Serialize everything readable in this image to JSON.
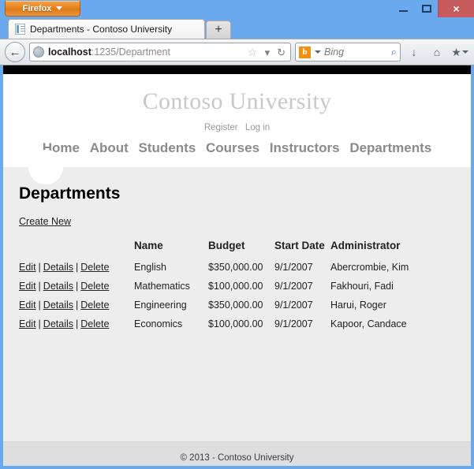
{
  "window": {
    "app_button_label": "Firefox",
    "controls": {
      "minimize": "minimize-icon",
      "maximize": "maximize-icon",
      "close": "×"
    }
  },
  "tabbar": {
    "active_tab_title": "Departments - Contoso University",
    "new_tab_label": "+"
  },
  "toolbar": {
    "back_glyph": "←",
    "url_host": "localhost",
    "url_rest": ":1235/Department",
    "star_glyph": "☆",
    "dropdown_glyph": "▾",
    "reload_glyph": "↻",
    "search_engine_letter": "b",
    "search_placeholder": "Bing",
    "search_glyph": "⌕",
    "download_glyph": "↓",
    "home_glyph": "⌂",
    "bookmarks_glyph": "★"
  },
  "site": {
    "title": "Contoso University",
    "account_links": [
      {
        "label": "Register"
      },
      {
        "label": "Log in"
      }
    ],
    "nav": [
      {
        "label": "Home"
      },
      {
        "label": "About"
      },
      {
        "label": "Students"
      },
      {
        "label": "Courses"
      },
      {
        "label": "Instructors"
      },
      {
        "label": "Departments"
      }
    ]
  },
  "main": {
    "page_title": "Departments",
    "create_new_label": "Create New",
    "table": {
      "headers": {
        "actions": "",
        "name": "Name",
        "budget": "Budget",
        "start_date": "Start Date",
        "administrator": "Administrator"
      },
      "row_actions": {
        "edit": "Edit",
        "details": "Details",
        "delete": "Delete",
        "separator": "|"
      },
      "rows": [
        {
          "name": "English",
          "budget": "$350,000.00",
          "start_date": "9/1/2007",
          "administrator": "Abercrombie, Kim"
        },
        {
          "name": "Mathematics",
          "budget": "$100,000.00",
          "start_date": "9/1/2007",
          "administrator": "Fakhouri, Fadi"
        },
        {
          "name": "Engineering",
          "budget": "$350,000.00",
          "start_date": "9/1/2007",
          "administrator": "Harui, Roger"
        },
        {
          "name": "Economics",
          "budget": "$100,000.00",
          "start_date": "9/1/2007",
          "administrator": "Kapoor, Candace"
        }
      ]
    }
  },
  "footer": {
    "copyright": "© 2013 - Contoso University"
  },
  "colors": {
    "window_chrome": "#6aa9ee",
    "close_button": "#c75b5b",
    "firefox_orange": "#e98422",
    "page_background": "#ededed",
    "footer_background": "#dedede",
    "site_title": "#c8c8c8",
    "nav_link": "#8b8b8b"
  }
}
